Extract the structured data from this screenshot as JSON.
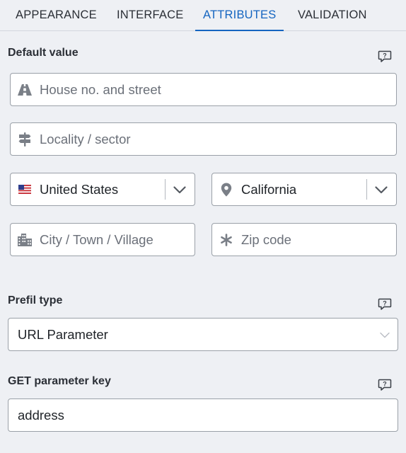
{
  "tabs": [
    {
      "label": "APPEARANCE",
      "active": false
    },
    {
      "label": "INTERFACE",
      "active": false
    },
    {
      "label": "ATTRIBUTES",
      "active": true
    },
    {
      "label": "VALIDATION",
      "active": false
    }
  ],
  "default_value": {
    "label": "Default value",
    "street_placeholder": "House no. and street",
    "locality_placeholder": "Locality / sector",
    "country_value": "United States",
    "state_value": "California",
    "city_placeholder": "City / Town / Village",
    "zip_placeholder": "Zip code"
  },
  "prefill": {
    "label": "Prefil type",
    "selected": "URL Parameter"
  },
  "get_param": {
    "label": "GET parameter key",
    "value": "address"
  },
  "colors": {
    "accent": "#1565c0",
    "background": "#eef0f4",
    "field_border": "#9aa0a8",
    "icon_gray": "#7a7f87"
  },
  "icons": {
    "street": "road-icon",
    "locality": "signpost-icon",
    "country": "us-flag-icon",
    "state": "map-pin-icon",
    "city": "city-buildings-icon",
    "zip": "asterisk-icon",
    "help": "help-bubble-icon",
    "dropdown": "chevron-down-icon"
  }
}
